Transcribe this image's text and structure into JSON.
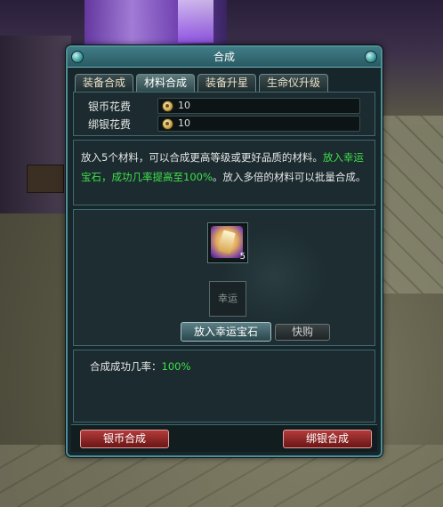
{
  "window": {
    "title": "合成"
  },
  "tabs": [
    {
      "label": "装备合成"
    },
    {
      "label": "材料合成"
    },
    {
      "label": "装备升星"
    },
    {
      "label": "生命仪升级"
    }
  ],
  "costs": {
    "silver_label": "银币花费",
    "silver_value": "10",
    "bound_label": "绑银花费",
    "bound_value": "10"
  },
  "description": {
    "part1": "放入5个材料，可以合成更高等级或更好品质的材料。",
    "part2_green": "放入幸运宝石，成功几率提高至100%",
    "part3": "。放入多倍的材料可以批量合成。"
  },
  "workspace": {
    "item_count": "5",
    "luck_slot_label": "幸运",
    "luck_button": "放入幸运宝石",
    "buy_button": "快购"
  },
  "rate": {
    "label": "合成成功几率：",
    "value": "100%"
  },
  "bottom": {
    "silver_button": "银币合成",
    "bound_button": "绑银合成"
  },
  "colors": {
    "accent_green": "#3fe04a",
    "frame_teal": "#4e8f98",
    "button_red": "#b33a3a"
  }
}
